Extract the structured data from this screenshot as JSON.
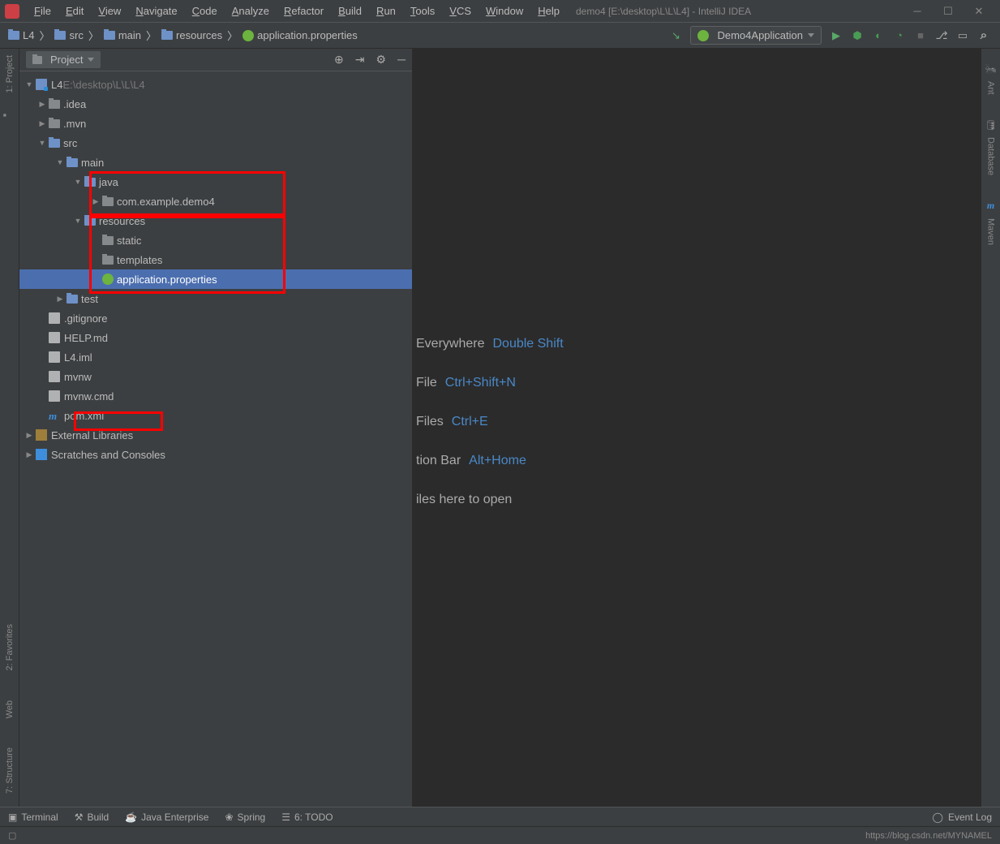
{
  "title": "demo4 [E:\\desktop\\L\\L\\L4] - IntelliJ IDEA",
  "menus": [
    "File",
    "Edit",
    "View",
    "Navigate",
    "Code",
    "Analyze",
    "Refactor",
    "Build",
    "Run",
    "Tools",
    "VCS",
    "Window",
    "Help"
  ],
  "breadcrumbs": [
    {
      "icon": "module",
      "label": "L4"
    },
    {
      "icon": "folder",
      "label": "src"
    },
    {
      "icon": "folder",
      "label": "main"
    },
    {
      "icon": "folder",
      "label": "resources"
    },
    {
      "icon": "spring",
      "label": "application.properties"
    }
  ],
  "run_config": "Demo4Application",
  "panel_title": "Project",
  "gutter_left": [
    "1: Project"
  ],
  "gutter_left_bottom": [
    "2: Favorites",
    "Web",
    "7: Structure"
  ],
  "gutter_right": [
    "Ant",
    "Database",
    "Maven"
  ],
  "tree": [
    {
      "indent": 0,
      "arrow": "down",
      "icon": "module",
      "label": "L4",
      "sublabel": "E:\\desktop\\L\\L\\L4"
    },
    {
      "indent": 1,
      "arrow": "right",
      "icon": "folder-grey",
      "label": ".idea"
    },
    {
      "indent": 1,
      "arrow": "right",
      "icon": "folder-grey",
      "label": ".mvn"
    },
    {
      "indent": 1,
      "arrow": "down",
      "icon": "folder",
      "label": "src"
    },
    {
      "indent": 2,
      "arrow": "down",
      "icon": "folder",
      "label": "main"
    },
    {
      "indent": 3,
      "arrow": "down",
      "icon": "folder",
      "label": "java"
    },
    {
      "indent": 4,
      "arrow": "right",
      "icon": "folder-grey",
      "label": "com.example.demo4"
    },
    {
      "indent": 3,
      "arrow": "down",
      "icon": "folder",
      "label": "resources"
    },
    {
      "indent": 4,
      "arrow": "none",
      "icon": "folder-grey",
      "label": "static"
    },
    {
      "indent": 4,
      "arrow": "none",
      "icon": "folder-grey",
      "label": "templates"
    },
    {
      "indent": 4,
      "arrow": "none",
      "icon": "spring",
      "label": "application.properties",
      "selected": true
    },
    {
      "indent": 2,
      "arrow": "right",
      "icon": "folder",
      "label": "test"
    },
    {
      "indent": 1,
      "arrow": "none",
      "icon": "file-txt",
      "label": ".gitignore"
    },
    {
      "indent": 1,
      "arrow": "none",
      "icon": "file-txt",
      "label": "HELP.md"
    },
    {
      "indent": 1,
      "arrow": "none",
      "icon": "file-txt",
      "label": "L4.iml"
    },
    {
      "indent": 1,
      "arrow": "none",
      "icon": "file-txt",
      "label": "mvnw"
    },
    {
      "indent": 1,
      "arrow": "none",
      "icon": "file-txt",
      "label": "mvnw.cmd"
    },
    {
      "indent": 1,
      "arrow": "none",
      "icon": "maven",
      "label": "pom.xml"
    },
    {
      "indent": 0,
      "arrow": "right",
      "icon": "lib",
      "label": "External Libraries"
    },
    {
      "indent": 0,
      "arrow": "right",
      "icon": "scratch",
      "label": "Scratches and Consoles"
    }
  ],
  "welcome": [
    {
      "text": "Everywhere",
      "shortcut": "Double Shift"
    },
    {
      "text": "File",
      "shortcut": "Ctrl+Shift+N"
    },
    {
      "text": "Files",
      "shortcut": "Ctrl+E"
    },
    {
      "text": "tion Bar",
      "shortcut": "Alt+Home"
    },
    {
      "text": "iles here to open",
      "shortcut": ""
    }
  ],
  "statusbar": {
    "items": [
      "Terminal",
      "Build",
      "Java Enterprise",
      "Spring",
      "6: TODO"
    ],
    "event_log": "Event Log"
  },
  "footer_url": "https://blog.csdn.net/MYNAMEL"
}
